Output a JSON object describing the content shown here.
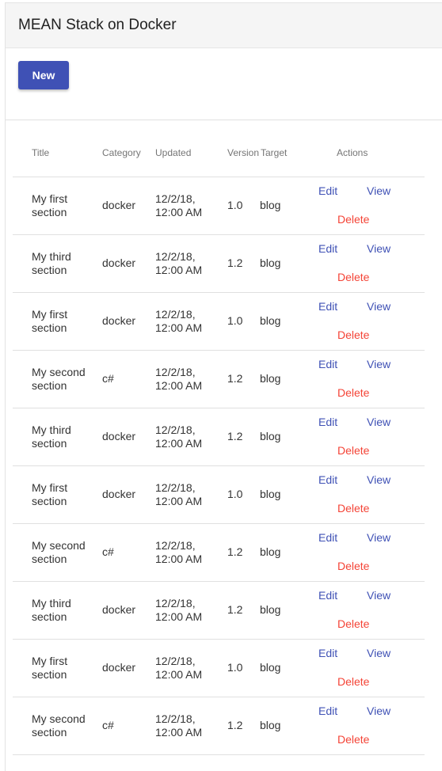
{
  "app": {
    "title": "MEAN Stack on Docker"
  },
  "toolbar": {
    "new_label": "New"
  },
  "table": {
    "headers": {
      "title": "Title",
      "category": "Category",
      "updated": "Updated",
      "version": "Version",
      "target": "Target",
      "actions": "Actions"
    },
    "action_labels": {
      "edit": "Edit",
      "view": "View",
      "delete": "Delete"
    },
    "rows": [
      {
        "title": "My first section",
        "category": "docker",
        "updated": "12/2/18, 12:00 AM",
        "version": "1.0",
        "target": "blog"
      },
      {
        "title": "My third section",
        "category": "docker",
        "updated": "12/2/18, 12:00 AM",
        "version": "1.2",
        "target": "blog"
      },
      {
        "title": "My first section",
        "category": "docker",
        "updated": "12/2/18, 12:00 AM",
        "version": "1.0",
        "target": "blog"
      },
      {
        "title": "My second section",
        "category": "c#",
        "updated": "12/2/18, 12:00 AM",
        "version": "1.2",
        "target": "blog"
      },
      {
        "title": "My third section",
        "category": "docker",
        "updated": "12/2/18, 12:00 AM",
        "version": "1.2",
        "target": "blog"
      },
      {
        "title": "My first section",
        "category": "docker",
        "updated": "12/2/18, 12:00 AM",
        "version": "1.0",
        "target": "blog"
      },
      {
        "title": "My second section",
        "category": "c#",
        "updated": "12/2/18, 12:00 AM",
        "version": "1.2",
        "target": "blog"
      },
      {
        "title": "My third section",
        "category": "docker",
        "updated": "12/2/18, 12:00 AM",
        "version": "1.2",
        "target": "blog"
      },
      {
        "title": "My first section",
        "category": "docker",
        "updated": "12/2/18, 12:00 AM",
        "version": "1.0",
        "target": "blog"
      },
      {
        "title": "My second section",
        "category": "c#",
        "updated": "12/2/18, 12:00 AM",
        "version": "1.2",
        "target": "blog"
      }
    ]
  },
  "colors": {
    "primary": "#3f51b5",
    "danger": "#f44336",
    "header_bg": "#f5f5f5"
  }
}
